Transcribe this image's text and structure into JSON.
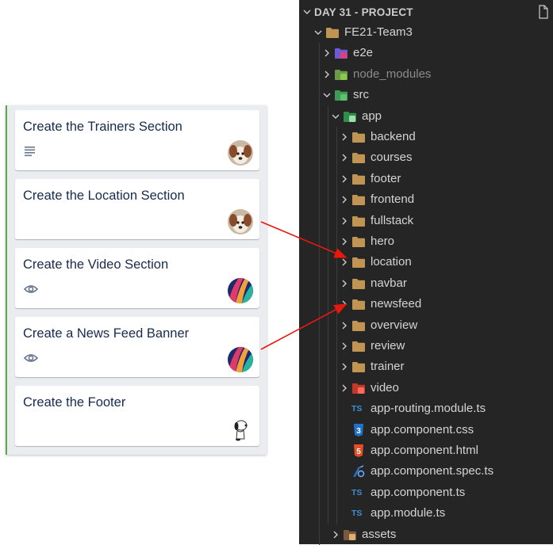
{
  "trello": {
    "cards": [
      {
        "title": "Create the Trainers Section",
        "badge": "description-icon",
        "avatar": "dog-avatar"
      },
      {
        "title": "Create the Location Section",
        "badge": "",
        "avatar": "dog-avatar"
      },
      {
        "title": "Create the Video Section",
        "badge": "watch-eye-icon",
        "avatar": "colorful-avatar"
      },
      {
        "title": "Create a News Feed Banner",
        "badge": "watch-eye-icon",
        "avatar": "colorful-avatar"
      },
      {
        "title": "Create the Footer",
        "badge": "",
        "avatar": "snoopy-avatar"
      }
    ]
  },
  "explorer": {
    "title": "DAY 31 - PROJECT",
    "tree": [
      {
        "label": "FE21-Team3",
        "type": "folder",
        "depth": 0,
        "expanded": true,
        "icon": "folder-icon"
      },
      {
        "label": "e2e",
        "type": "folder",
        "depth": 1,
        "expanded": false,
        "icon": "e2e-folder-icon"
      },
      {
        "label": "node_modules",
        "type": "folder",
        "depth": 1,
        "expanded": false,
        "icon": "node-folder-icon",
        "dim": true
      },
      {
        "label": "src",
        "type": "folder",
        "depth": 1,
        "expanded": true,
        "icon": "src-folder-icon"
      },
      {
        "label": "app",
        "type": "folder",
        "depth": 2,
        "expanded": true,
        "icon": "app-folder-icon"
      },
      {
        "label": "backend",
        "type": "folder",
        "depth": 3,
        "expanded": false,
        "icon": "folder-icon"
      },
      {
        "label": "courses",
        "type": "folder",
        "depth": 3,
        "expanded": false,
        "icon": "folder-icon"
      },
      {
        "label": "footer",
        "type": "folder",
        "depth": 3,
        "expanded": false,
        "icon": "folder-icon"
      },
      {
        "label": "frontend",
        "type": "folder",
        "depth": 3,
        "expanded": false,
        "icon": "folder-icon"
      },
      {
        "label": "fullstack",
        "type": "folder",
        "depth": 3,
        "expanded": false,
        "icon": "folder-icon"
      },
      {
        "label": "hero",
        "type": "folder",
        "depth": 3,
        "expanded": false,
        "icon": "folder-icon"
      },
      {
        "label": "location",
        "type": "folder",
        "depth": 3,
        "expanded": false,
        "icon": "folder-icon"
      },
      {
        "label": "navbar",
        "type": "folder",
        "depth": 3,
        "expanded": false,
        "icon": "folder-icon"
      },
      {
        "label": "newsfeed",
        "type": "folder",
        "depth": 3,
        "expanded": false,
        "icon": "folder-icon"
      },
      {
        "label": "overview",
        "type": "folder",
        "depth": 3,
        "expanded": false,
        "icon": "folder-icon"
      },
      {
        "label": "review",
        "type": "folder",
        "depth": 3,
        "expanded": false,
        "icon": "folder-icon"
      },
      {
        "label": "trainer",
        "type": "folder",
        "depth": 3,
        "expanded": false,
        "icon": "folder-icon"
      },
      {
        "label": "video",
        "type": "folder",
        "depth": 3,
        "expanded": false,
        "icon": "video-folder-icon"
      },
      {
        "label": "app-routing.module.ts",
        "type": "file",
        "depth": 3,
        "icon": "typescript-icon"
      },
      {
        "label": "app.component.css",
        "type": "file",
        "depth": 3,
        "icon": "css-icon"
      },
      {
        "label": "app.component.html",
        "type": "file",
        "depth": 3,
        "icon": "html-icon"
      },
      {
        "label": "app.component.spec.ts",
        "type": "file",
        "depth": 3,
        "icon": "test-spec-icon"
      },
      {
        "label": "app.component.ts",
        "type": "file",
        "depth": 3,
        "icon": "typescript-icon"
      },
      {
        "label": "app.module.ts",
        "type": "file",
        "depth": 3,
        "icon": "typescript-icon"
      },
      {
        "label": "assets",
        "type": "folder",
        "depth": 2,
        "expanded": false,
        "icon": "assets-folder-icon"
      }
    ],
    "ts_glyph": "TS"
  },
  "annotations": {
    "color": "#e8180e",
    "arrows": [
      {
        "from": "Create the Location Section",
        "to": "location"
      },
      {
        "from": "Create a News Feed Banner",
        "to": "newsfeed"
      }
    ]
  }
}
